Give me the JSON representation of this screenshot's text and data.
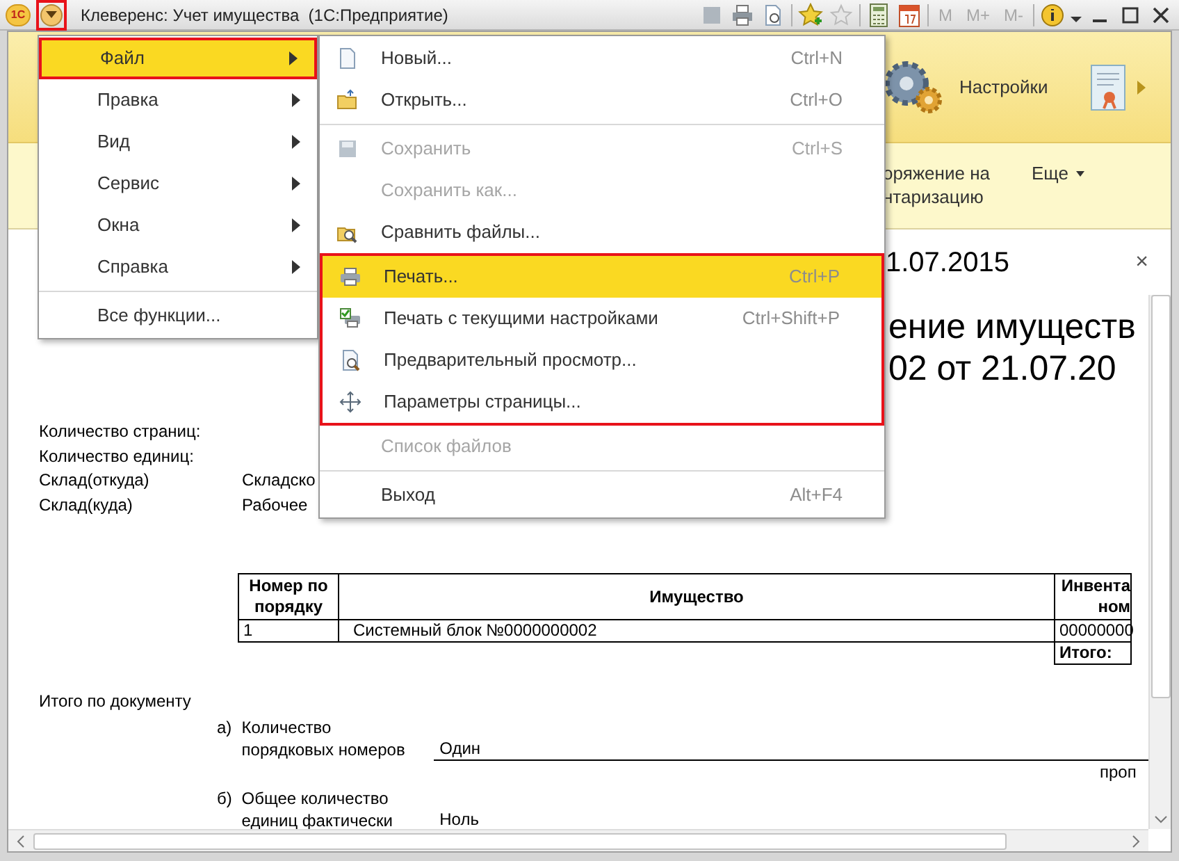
{
  "window": {
    "title": "Клеверенс: Учет имущества  (1С:Предприятие)",
    "logo": "1С",
    "memory_buttons": [
      {
        "label": "M"
      },
      {
        "label": "M+"
      },
      {
        "label": "M-"
      }
    ]
  },
  "panel": {
    "sections": [
      {
        "label": "Настройки"
      }
    ]
  },
  "command_bar": {
    "commands": [
      {
        "lines": [
          "оряжение на",
          "нтаризацию"
        ]
      }
    ],
    "more": "Еще"
  },
  "document_tab": {
    "title": "1.07.2015",
    "close": "×"
  },
  "document": {
    "heading_lines": [
      "ение имуществ",
      "02 от 21.07.20"
    ],
    "fields": [
      {
        "label": "Количество страниц:"
      },
      {
        "label": "Количество единиц:"
      },
      {
        "label": "Склад(откуда)",
        "value": "Складско"
      },
      {
        "label": "Склад(куда)",
        "value": "Рабочее"
      }
    ],
    "table": {
      "columns": [
        {
          "lines": [
            "Номер по",
            "порядку"
          ]
        },
        {
          "lines": [
            "Имущество"
          ]
        },
        {
          "lines": [
            "Инвента",
            "ном"
          ]
        }
      ],
      "rows": [
        [
          "1",
          "Системный блок №0000000002",
          "00000000"
        ]
      ],
      "total_label": "Итого:"
    },
    "summary": {
      "title": "Итого по документу",
      "lines": [
        {
          "marker": "а)",
          "label": [
            "Количество",
            "порядковых номеров"
          ],
          "value": "Один",
          "caption": "проп"
        },
        {
          "marker": "б)",
          "label": [
            "Общее количество",
            "единиц фактически"
          ],
          "value": "Ноль"
        }
      ]
    }
  },
  "main_menu": {
    "items": [
      {
        "kind": "item",
        "label": "Файл",
        "selected": true,
        "submenu": true
      },
      {
        "kind": "item",
        "label": "Правка",
        "selected": false,
        "submenu": true
      },
      {
        "kind": "item",
        "label": "Вид",
        "selected": false,
        "submenu": true
      },
      {
        "kind": "item",
        "label": "Сервис",
        "selected": false,
        "submenu": true
      },
      {
        "kind": "item",
        "label": "Окна",
        "selected": false,
        "submenu": true
      },
      {
        "kind": "item",
        "label": "Справка",
        "selected": false,
        "submenu": true
      },
      {
        "kind": "separator"
      },
      {
        "kind": "item",
        "label": "Все функции...",
        "selected": false,
        "submenu": false
      }
    ]
  },
  "file_menu": {
    "items": [
      {
        "kind": "item",
        "label": "Новый...",
        "shortcut": "Ctrl+N",
        "disabled": false,
        "selected": false
      },
      {
        "kind": "item",
        "label": "Открыть...",
        "shortcut": "Ctrl+O",
        "disabled": false,
        "selected": false
      },
      {
        "kind": "separator"
      },
      {
        "kind": "item",
        "label": "Сохранить",
        "shortcut": "Ctrl+S",
        "disabled": true,
        "selected": false
      },
      {
        "kind": "item",
        "label": "Сохранить как...",
        "disabled": true,
        "selected": false
      },
      {
        "kind": "item",
        "label": "Сравнить файлы...",
        "disabled": false,
        "selected": false
      },
      {
        "kind": "group_start"
      },
      {
        "kind": "item",
        "label": "Печать...",
        "shortcut": "Ctrl+P",
        "disabled": false,
        "selected": true
      },
      {
        "kind": "item",
        "label": "Печать с текущими настройками",
        "shortcut": "Ctrl+Shift+P",
        "disabled": false,
        "selected": false
      },
      {
        "kind": "item",
        "label": "Предварительный просмотр...",
        "disabled": false,
        "selected": false
      },
      {
        "kind": "item",
        "label": "Параметры страницы...",
        "disabled": false,
        "selected": false
      },
      {
        "kind": "group_end"
      },
      {
        "kind": "item",
        "label": "Список файлов",
        "disabled": true,
        "selected": false
      },
      {
        "kind": "separator"
      },
      {
        "kind": "item",
        "label": "Выход",
        "shortcut": "Alt+F4",
        "disabled": false,
        "selected": false
      }
    ]
  }
}
